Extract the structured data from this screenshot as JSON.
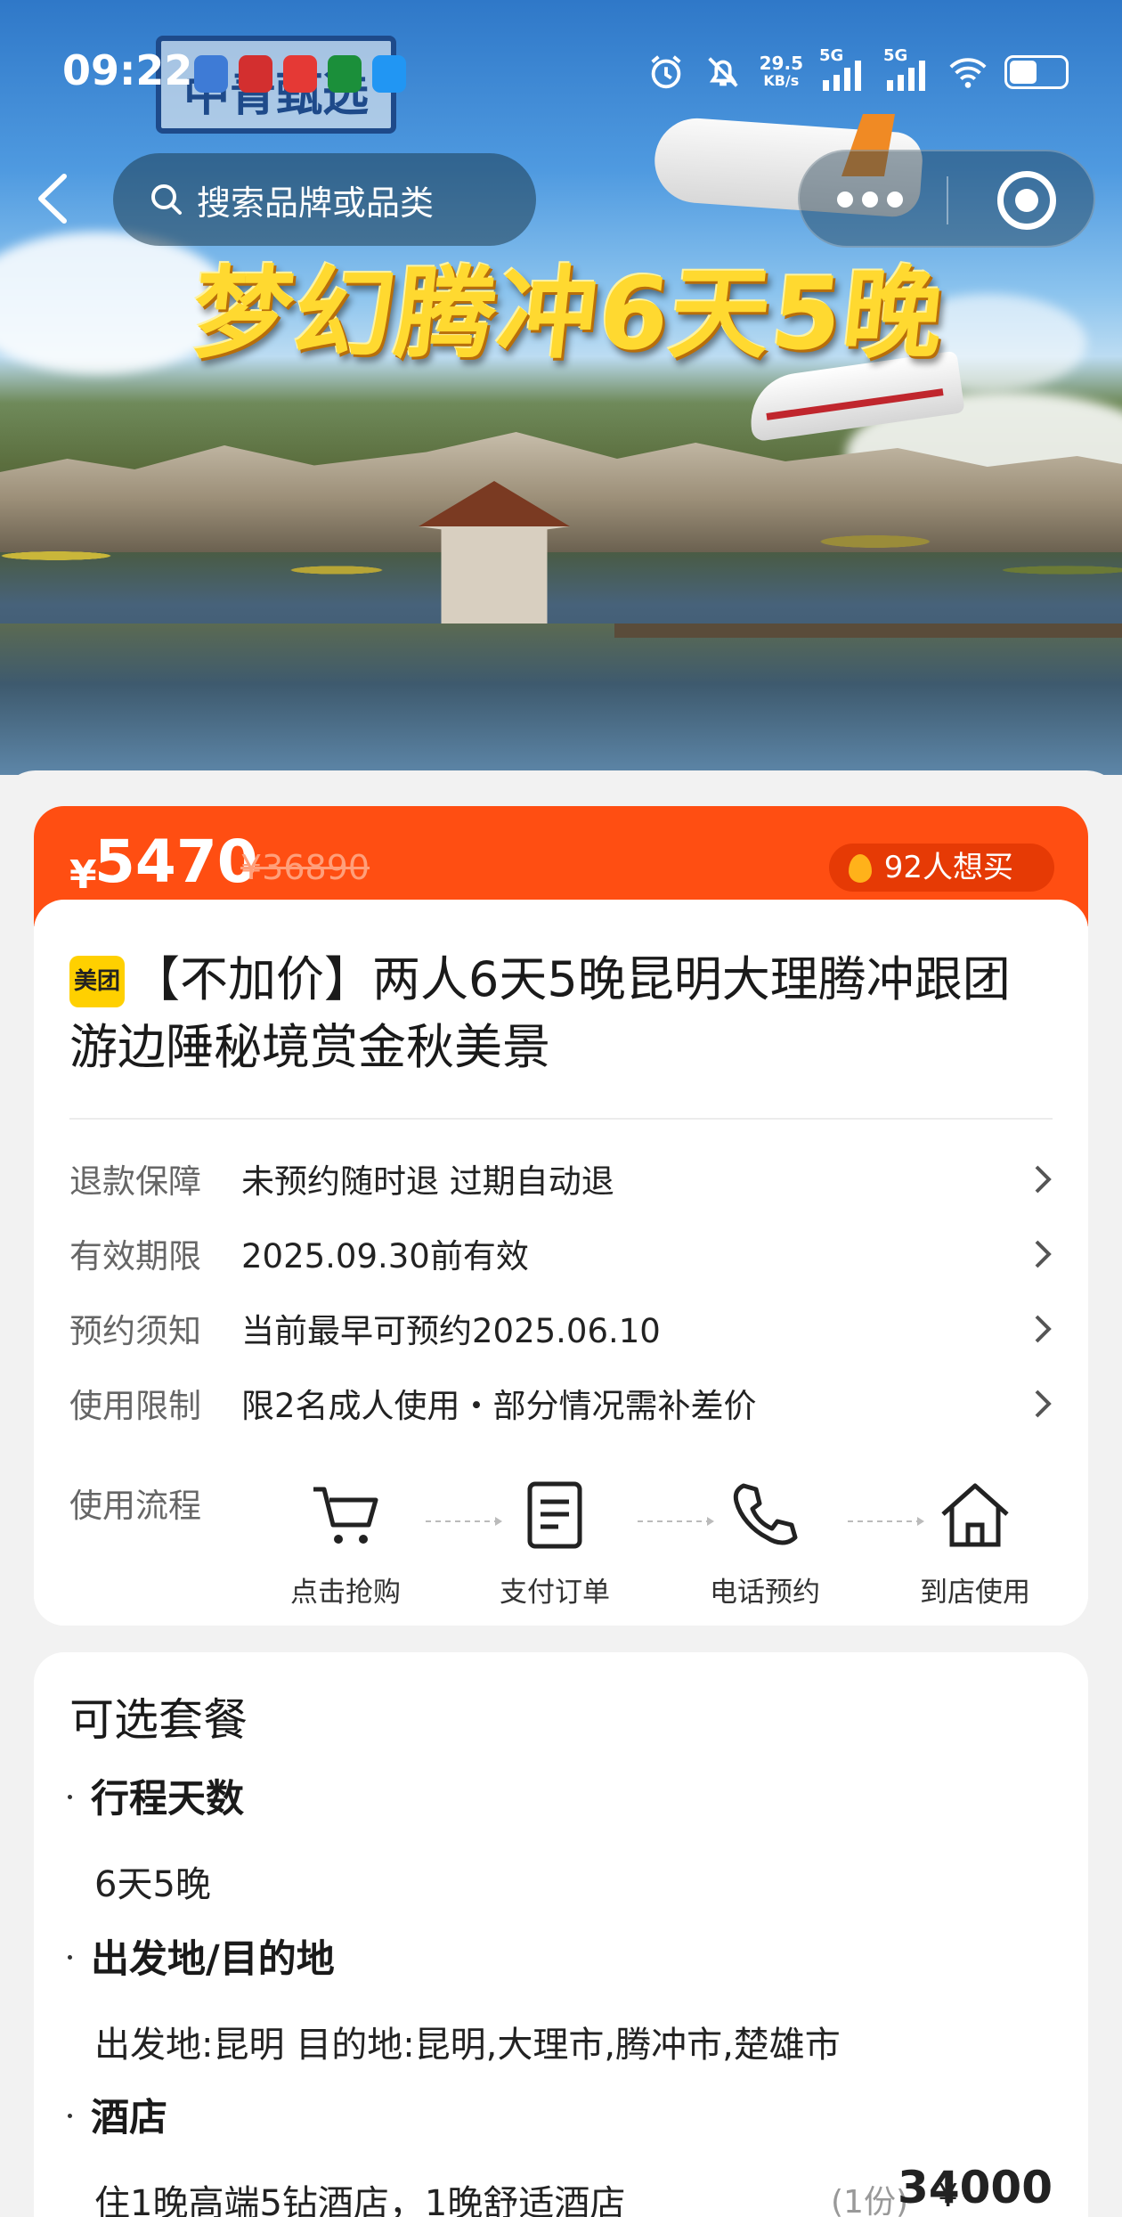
{
  "status_bar": {
    "time": "09:22",
    "net_speed": "29.5",
    "net_unit": "KB/s",
    "signal1": "5G",
    "signal2": "5G"
  },
  "nav": {
    "search_placeholder": "搜索品牌或品类"
  },
  "hero": {
    "title": "梦幻腾冲6天5晚",
    "sign_text": "中青甄选"
  },
  "price": {
    "currency": "¥",
    "current": "5470",
    "original": "¥36890",
    "want_count": "92人想买"
  },
  "product": {
    "brand_badge": "美团",
    "title": "【不加价】两人6天5晚昆明大理腾冲跟团游边陲秘境赏金秋美景"
  },
  "info_rows": [
    {
      "label": "退款保障",
      "value": "未预约随时退 过期自动退"
    },
    {
      "label": "有效期限",
      "value": "2025.09.30前有效"
    },
    {
      "label": "预约须知",
      "value": "当前最早可预约2025.06.10"
    },
    {
      "label": "使用限制",
      "value": "限2名成人使用・部分情况需补差价"
    }
  ],
  "flow": {
    "label": "使用流程",
    "steps": [
      "点击抢购",
      "支付订单",
      "电话预约",
      "到店使用"
    ]
  },
  "packages": {
    "title": "可选套餐",
    "sections": [
      {
        "heading": "行程天数",
        "value": "6天5晚"
      },
      {
        "heading": "出发地/目的地",
        "value": "出发地:昆明 目的地:昆明,大理市,腾冲市,楚雄市"
      },
      {
        "heading": "酒店",
        "value": "住1晚高端5钻酒店，1晚舒适酒店"
      }
    ],
    "hotel_qty": "(1份)",
    "hotel_currency": "¥",
    "hotel_price": "34000"
  },
  "colors": {
    "accent": "#ff4e12",
    "brand_yellow": "#ffd000"
  }
}
